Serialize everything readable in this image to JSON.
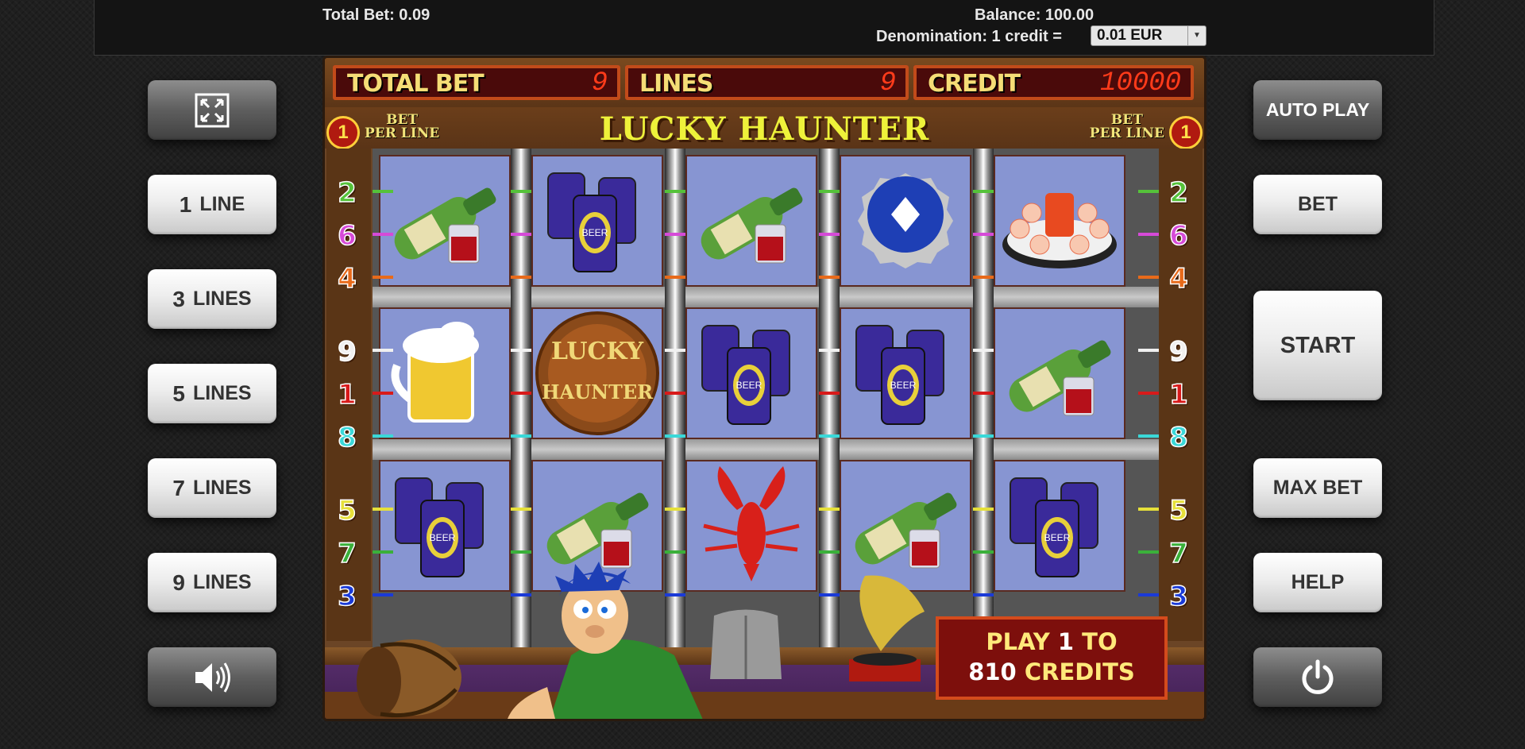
{
  "topbar": {
    "total_bet": "Total Bet: 0.09",
    "balance": "Balance: 100.00",
    "denomination_label": "Denomination: 1 credit =",
    "denomination_value": "0.01 EUR"
  },
  "left_buttons": {
    "line1": {
      "num": "1",
      "label": "LINE"
    },
    "line3": {
      "num": "3",
      "label": "LINES"
    },
    "line5": {
      "num": "5",
      "label": "LINES"
    },
    "line7": {
      "num": "7",
      "label": "LINES"
    },
    "line9": {
      "num": "9",
      "label": "LINES"
    }
  },
  "right_buttons": {
    "auto_play": "AUTO PLAY",
    "bet": "BET",
    "start": "START",
    "max_bet": "MAX BET",
    "help": "HELP"
  },
  "hud": {
    "total_bet_label": "TOTAL BET",
    "total_bet_value": "9",
    "lines_label": "LINES",
    "lines_value": "9",
    "credit_label": "CREDIT",
    "credit_value": "10000"
  },
  "game": {
    "title": "LUCKY HAUNTER",
    "bet_per_line_value": "1",
    "bet_label_line1": "BET",
    "bet_label_line2": "PER LINE"
  },
  "line_numbers_left": [
    "2",
    "6",
    "4",
    "9",
    "1",
    "8",
    "5",
    "7",
    "3"
  ],
  "line_numbers_right": [
    "2",
    "6",
    "4",
    "9",
    "1",
    "8",
    "5",
    "7",
    "3"
  ],
  "line_colors": {
    "2": "#55c23a",
    "6": "#d64ad8",
    "4": "#e86a1a",
    "9": "#f0f0f0",
    "1": "#d81a1a",
    "8": "#3ad8d8",
    "5": "#e6e03a",
    "7": "#3ab03a",
    "3": "#1a3ad8"
  },
  "reels": [
    [
      "wine-bottle",
      "beer-mug",
      "beer-cans"
    ],
    [
      "beer-cans",
      "lucky-haunter-logo",
      "wine-bottle"
    ],
    [
      "wine-bottle",
      "beer-cans",
      "lobster"
    ],
    [
      "bottle-cap",
      "beer-cans",
      "wine-bottle"
    ],
    [
      "shrimp-plate",
      "wine-bottle",
      "beer-cans"
    ]
  ],
  "symbol_text": {
    "beer_can": "BEER",
    "logo_top": "LUCKY",
    "logo_bottom": "HAUNTER"
  },
  "promo": {
    "line1_a": "PLAY ",
    "line1_b": "1",
    "line1_c": " TO",
    "line2_a": "810",
    "line2_b": " CREDITS"
  }
}
